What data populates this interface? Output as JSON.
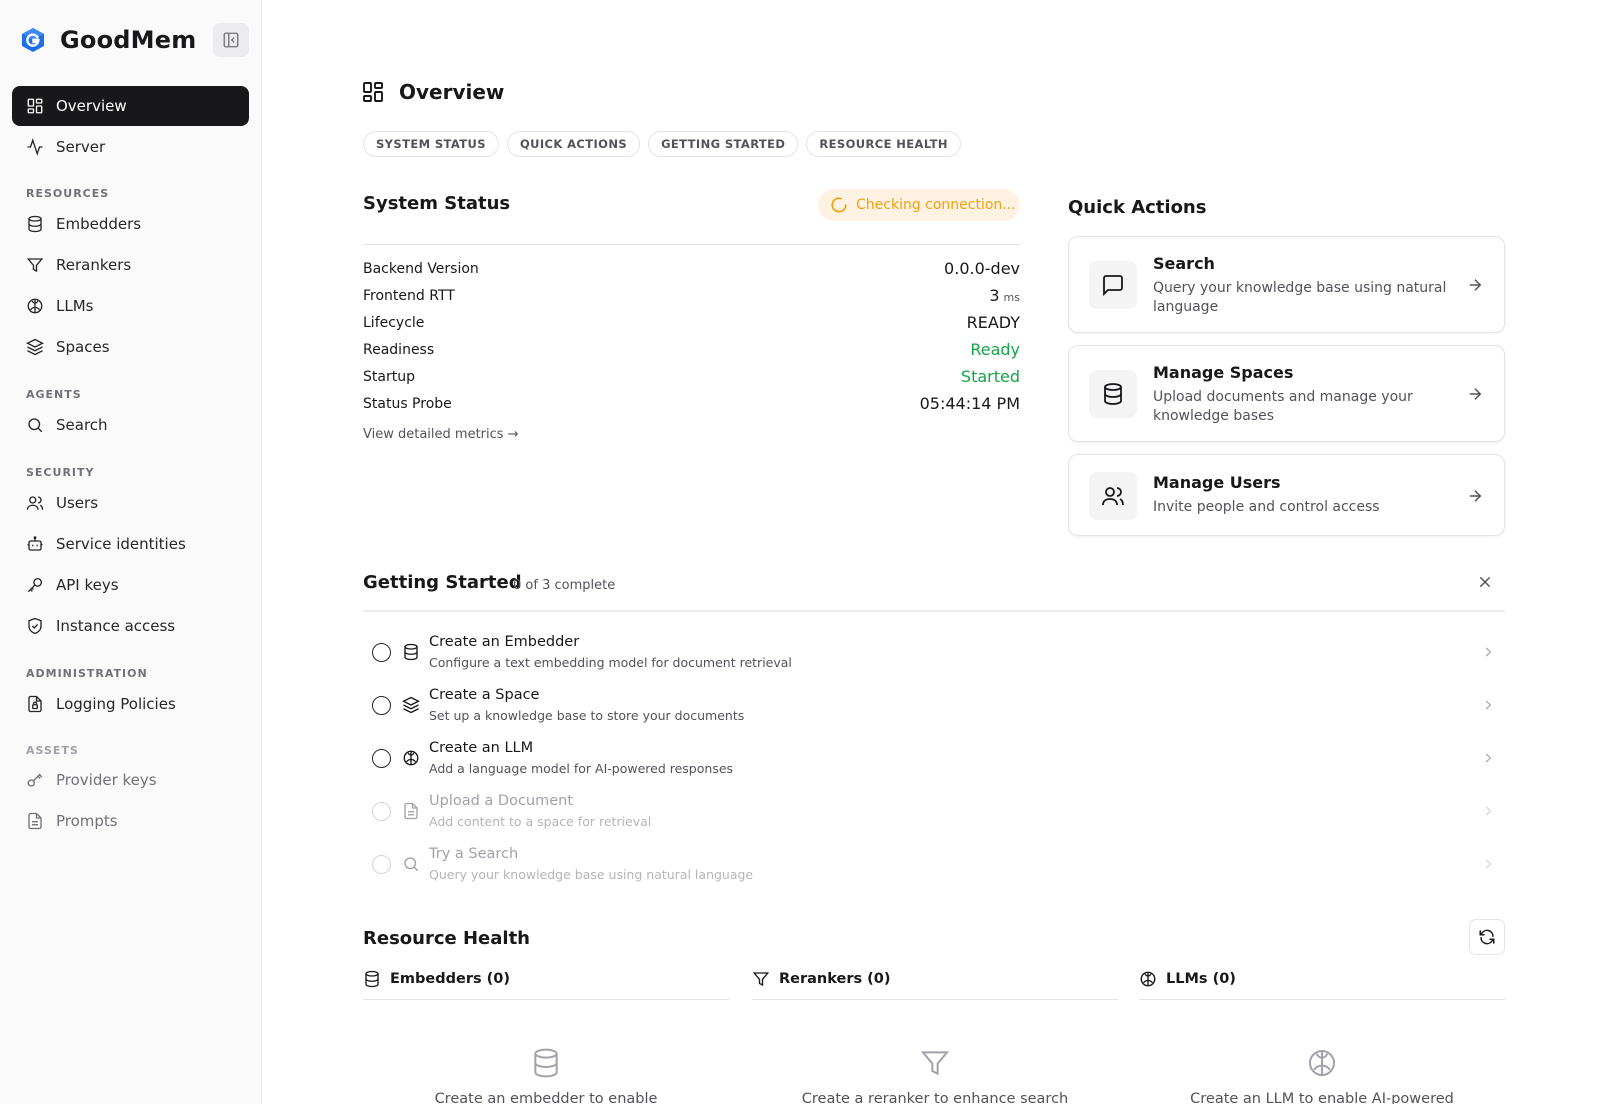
{
  "sidebar": {
    "brand": "GoodMem",
    "items": [
      {
        "label": "Overview"
      },
      {
        "label": "Server"
      },
      {
        "label": "Embedders"
      },
      {
        "label": "Rerankers"
      },
      {
        "label": "LLMs"
      },
      {
        "label": "Spaces"
      },
      {
        "label": "Search"
      },
      {
        "label": "Users"
      },
      {
        "label": "Service identities"
      },
      {
        "label": "API keys"
      },
      {
        "label": "Instance access"
      },
      {
        "label": "Logging Policies"
      },
      {
        "label": "Provider keys"
      },
      {
        "label": "Prompts"
      }
    ],
    "sections": [
      "RESOURCES",
      "AGENTS",
      "SECURITY",
      "ADMINISTRATION",
      "ASSETS"
    ]
  },
  "page": {
    "title": "Overview",
    "pills": [
      "SYSTEM STATUS",
      "QUICK ACTIONS",
      "GETTING STARTED",
      "RESOURCE HEALTH"
    ]
  },
  "system_status": {
    "title": "System Status",
    "badge": "Checking connection...",
    "rows": [
      {
        "label": "Backend Version",
        "value": "0.0.0-dev"
      },
      {
        "label": "Frontend RTT",
        "value": "3",
        "unit": "ms"
      },
      {
        "label": "Lifecycle",
        "value": "READY"
      },
      {
        "label": "Readiness",
        "value": "Ready"
      },
      {
        "label": "Startup",
        "value": "Started"
      },
      {
        "label": "Status Probe",
        "value": "05:44:14 PM"
      }
    ],
    "metrics_link": "View detailed metrics →"
  },
  "quick_actions": {
    "title": "Quick Actions",
    "cards": [
      {
        "title": "Search",
        "desc": "Query your knowledge base using natural language"
      },
      {
        "title": "Manage Spaces",
        "desc": "Upload documents and manage your knowledge bases"
      },
      {
        "title": "Manage Users",
        "desc": "Invite people and control access"
      }
    ]
  },
  "getting_started": {
    "title": "Getting Started",
    "count": "0 of 3 complete",
    "steps": [
      {
        "title": "Create an Embedder",
        "desc": "Configure a text embedding model for document retrieval"
      },
      {
        "title": "Create a Space",
        "desc": "Set up a knowledge base to store your documents"
      },
      {
        "title": "Create an LLM",
        "desc": "Add a language model for AI-powered responses"
      },
      {
        "title": "Upload a Document",
        "desc": "Add content to a space for retrieval"
      },
      {
        "title": "Try a Search",
        "desc": "Query your knowledge base using natural language"
      }
    ]
  },
  "resource_health": {
    "title": "Resource Health",
    "columns": [
      {
        "title": "Embedders (0)",
        "empty": "Create an embedder to enable"
      },
      {
        "title": "Rerankers (0)",
        "empty": "Create a reranker to enhance search"
      },
      {
        "title": "LLMs (0)",
        "empty": "Create an LLM to enable AI-powered"
      }
    ]
  },
  "colors": {
    "accent_dark": "#18181b",
    "warning": "#f59e0b",
    "success": "#16a34a",
    "brand_blue": "#1d6fe8"
  }
}
